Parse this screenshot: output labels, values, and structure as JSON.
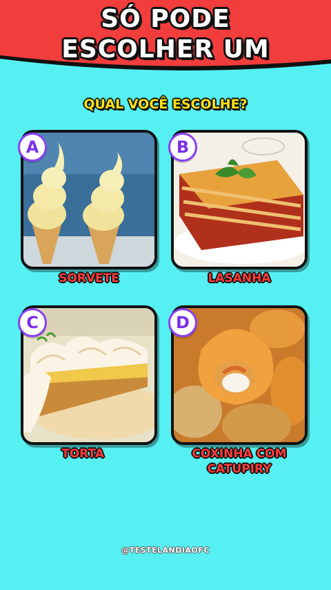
{
  "header": {
    "title_line1": "SÓ PODE",
    "title_line2": "ESCOLHER UM"
  },
  "question": "QUAL VOCÊ ESCOLHE?",
  "options": [
    {
      "letter": "A",
      "label_line1": "SORVETE",
      "label_line2": "",
      "image": "ice-cream-cones"
    },
    {
      "letter": "B",
      "label_line1": "LASANHA",
      "label_line2": "",
      "image": "lasagna"
    },
    {
      "letter": "C",
      "label_line1": "TORTA",
      "label_line2": "",
      "image": "meringue-pie"
    },
    {
      "letter": "D",
      "label_line1": "COXINHA COM",
      "label_line2": "CATUPIRY",
      "image": "coxinha"
    }
  ],
  "watermark": "@TESTELANDIAOFC",
  "colors": {
    "background": "#56f0f2",
    "banner": "#f23d3d",
    "question": "#ffe11a",
    "label": "#ff3b3b",
    "badge_border": "#8a3ff0"
  }
}
